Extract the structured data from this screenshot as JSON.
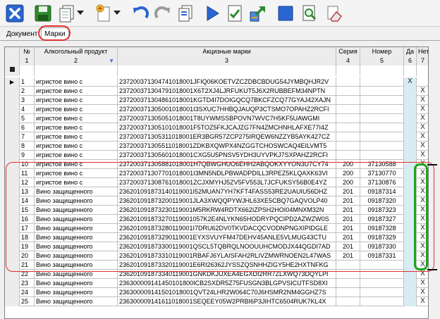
{
  "toolbar": {
    "buttons": [
      {
        "name": "close-icon",
        "color": "#2a66d0"
      },
      {
        "name": "save-icon",
        "color": "#2f8a2f"
      },
      {
        "name": "copy-doc-icon",
        "color": "#ffffff"
      },
      {
        "name": "new-doc-icon",
        "color": "#f0c040"
      },
      {
        "name": "undo-icon",
        "color": "#2a66d0"
      },
      {
        "name": "redo-icon",
        "color": "#9a9a9a"
      },
      {
        "name": "paste-doc-icon",
        "color": "#ffffff"
      },
      {
        "name": "play-icon",
        "color": "#2a66d0"
      },
      {
        "name": "check-doc-icon",
        "color": "#2f8a2f"
      },
      {
        "name": "export-icon",
        "color": "#2f8a2f"
      },
      {
        "name": "blue-square-icon",
        "color": "#2a66d0"
      },
      {
        "name": "search-doc-icon",
        "color": "#2f8a2f"
      },
      {
        "name": "eraser-icon",
        "color": "#c04040"
      }
    ]
  },
  "tabs": [
    {
      "label": "Документ"
    },
    {
      "label": "Марки"
    }
  ],
  "grid": {
    "headers": [
      "№",
      "Алкогольный продукт",
      "Акцизные марки",
      "Серия",
      "Номер",
      "Да",
      "Нет"
    ],
    "header_numbers": [
      "1",
      "2",
      "3",
      "4",
      "5",
      "6",
      "7"
    ],
    "rows": [
      {
        "n": "1",
        "product": "игристое вино с",
        "mark": "237200371304741018001JFIQ06KOETVZCZDBCBDUG54JYMBQHJR2V",
        "seria": "",
        "nomer": "",
        "da": "X",
        "net": ""
      },
      {
        "n": "2",
        "product": "игристое вино с",
        "mark": "237200371304791018001X6T2XJ4LJRFUKUT5J6X2RUBBEFM34NPTN",
        "seria": "",
        "nomer": "",
        "da": "",
        "net": "X"
      },
      {
        "n": "3",
        "product": "игристое вино с",
        "mark": "237200371304861018001KGTD4I7DOIGQCQ7BKCFZCQ77GYAJ42XAJN",
        "seria": "",
        "nomer": "",
        "da": "",
        "net": "X"
      },
      {
        "n": "4",
        "product": "игристое вино с",
        "mark": "237200371305001018001I3SXUC7HHBQJAUQP3CTSMO7OPAHZ2RCFI",
        "seria": "",
        "nomer": "",
        "da": "",
        "net": "X"
      },
      {
        "n": "5",
        "product": "игристое вино с",
        "mark": "237200371305051018001T8UYWMSSBPOVN7WVC7H5KF5UAWGMI",
        "seria": "",
        "nomer": "",
        "da": "",
        "net": "X"
      },
      {
        "n": "6",
        "product": "игристое вино с",
        "mark": "237200371305101018001F5TOZ5FKJCAJZG7FN4ZMCHNHLAFXE77I4Z",
        "seria": "",
        "nomer": "",
        "da": "",
        "net": "X"
      },
      {
        "n": "7",
        "product": "игристое вино с",
        "mark": "237200371305311018001ER3BGR57ZCP275IRQEW6NZZYB5AYK427CZ",
        "seria": "",
        "nomer": "",
        "da": "",
        "net": "X"
      },
      {
        "n": "8",
        "product": "игристое вино с",
        "mark": "237200371305511018001ZDKBXQWPX4NZGGTCHOSWCAQ4EILVMT5",
        "seria": "",
        "nomer": "",
        "da": "",
        "net": "X"
      },
      {
        "n": "9",
        "product": "игристое вино с",
        "mark": "237200371305601018001CXG5U5PNSV5YDH3UYVPKJ7SXPAHZ2RCFI",
        "seria": "",
        "nomer": "",
        "da": "",
        "net": "X"
      },
      {
        "n": "10",
        "product": "игристое вино с",
        "mark": "237200371305881018001H7QBWGHUO6EHH2ABQOKXYYON3U7CY74",
        "seria": "200",
        "nomer": "37130588",
        "da": "",
        "net": "X"
      },
      {
        "n": "11",
        "product": "игристое вино с",
        "mark": "237200371307701018001I3MN5NDLPBWADPDILL3RPEZ5KLQAXK63VI",
        "seria": "200",
        "nomer": "37130770",
        "da": "",
        "net": "X"
      },
      {
        "n": "12",
        "product": "игристое вино с",
        "mark": "237200371308761018001ZCJXMYHJ5ZV5FV553L7JCFUKSY56B0E4YZ",
        "seria": "200",
        "nomer": "37130876",
        "da": "",
        "net": "X"
      },
      {
        "n": "13",
        "product": "Вино защищенного",
        "mark": "236201091873140119001I52MUAN7YH7KFT4FASS53RE2UAUIU56DHZ",
        "seria": "201",
        "nomer": "09187314",
        "da": "",
        "net": "X"
      },
      {
        "n": "14",
        "product": "Вино защищенного",
        "mark": "236201091873200119001JLA3XWQQPYWJHL63XE5CBQ7GAQVOLP40",
        "seria": "201",
        "nomer": "09187320",
        "da": "",
        "net": "X"
      },
      {
        "n": "15",
        "product": "Вино защищенного",
        "mark": "236201091873230119001M5RKRW4RDTX662IZPSH2HOI04MNXM32N",
        "seria": "201",
        "nomer": "09187323",
        "da": "",
        "net": "X"
      },
      {
        "n": "16",
        "product": "Вино защищенного",
        "mark": "236201091873270119001057K2E4NLYKN65HODRYPQCIPD2AZWZW0S",
        "seria": "201",
        "nomer": "09187327",
        "da": "",
        "net": "X"
      },
      {
        "n": "17",
        "product": "Вино защищенного",
        "mark": "236201091873280119001I7DRU62DV0TKVDACQCVODNPNGXIPIDGLE",
        "seria": "201",
        "nomer": "09187328",
        "da": "",
        "net": "X"
      },
      {
        "n": "18",
        "product": "Вино защищенного",
        "mark": "236201091873290119001EYXSVUYFM47DEHV45ANLE5VLMUG43CTU",
        "seria": "201",
        "nomer": "09187329",
        "da": "",
        "net": "X"
      },
      {
        "n": "19",
        "product": "Вино защищенного",
        "mark": "236201091873300119001QSCL5TQBRQLNOOUUHCMODJX44QGDI7AD",
        "seria": "201",
        "nomer": "09187330",
        "da": "",
        "net": "X"
      },
      {
        "n": "20",
        "product": "Вино защищенного",
        "mark": "236201091873310119001RBAFJ6YLAISFAH2RLIVZMWRNOEN2L47WAS",
        "seria": "201",
        "nomer": "09187331",
        "da": "",
        "net": "X"
      },
      {
        "n": "21",
        "product": "Вино защищенного",
        "mark": "236201091873320119001E6RI26362JYSSZQSNHHZIGY5HE2HXTNFKG",
        "seria": "",
        "nomer": "",
        "da": "",
        "net": "X"
      },
      {
        "n": "22",
        "product": "Вино защищенного",
        "mark": "236201091873340119001GNKDKJUXEA4EGXDI2RR7ZLXWQ73DQYLPI",
        "seria": "",
        "nomer": "",
        "da": "",
        "net": "X"
      },
      {
        "n": "23",
        "product": "Вино защищенного",
        "mark": "236300009141450101800ICB2SXDR5Z75FUSGN3BLGPVSICUTFSD8XI",
        "seria": "",
        "nomer": "",
        "da": "",
        "net": "X"
      },
      {
        "n": "24",
        "product": "Вино защищенного",
        "mark": "236300009141501018001QVT24LHR2W064C70J6HSMR2NM4GGHZ7S",
        "seria": "",
        "nomer": "",
        "da": "",
        "net": "X"
      },
      {
        "n": "25",
        "product": "Вино защищенного",
        "mark": "236300009141611018001SEQEEY05W2PRBI6P3JIHTC6504RUK7KL4X",
        "seria": "",
        "nomer": "",
        "da": "",
        "net": "X"
      }
    ]
  }
}
